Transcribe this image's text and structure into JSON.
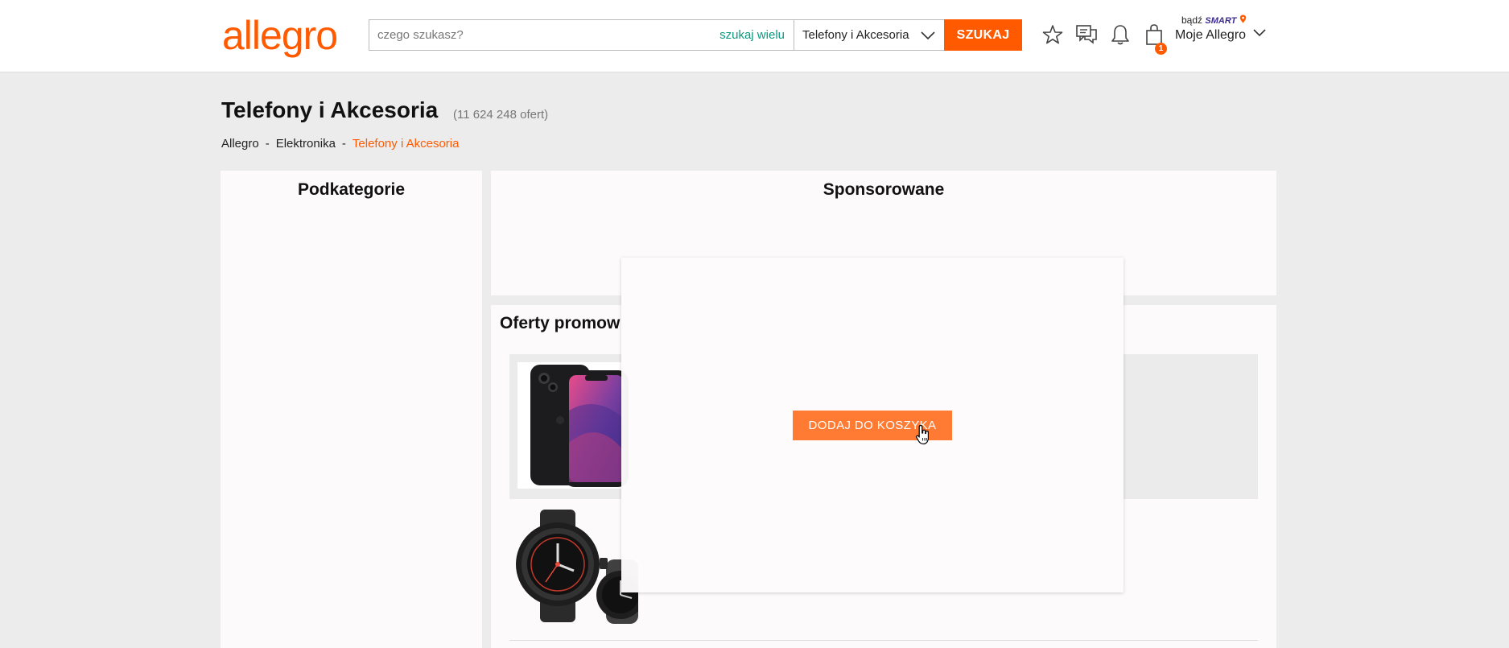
{
  "header": {
    "logo_text": "allegro",
    "search": {
      "placeholder": "czego szukasz?",
      "many_label": "szukaj wielu",
      "category_value": "Telefony i Akcesoria",
      "button_label": "SZUKAJ"
    },
    "cart_count": "1",
    "smart_prefix": "bądź",
    "smart_label": "SMART",
    "my_allegro_label": "Moje Allegro",
    "icons": [
      "star-icon",
      "messages-icon",
      "bell-icon",
      "cart-icon",
      "location-pin-icon",
      "chevron-down-icon"
    ]
  },
  "page": {
    "title": "Telefony i Akcesoria",
    "offer_count": "(11 624 248 ofert)",
    "breadcrumb": [
      {
        "label": "Allegro"
      },
      {
        "label": "Elektronika"
      },
      {
        "label": "Telefony i Akcesoria"
      }
    ],
    "breadcrumb_separator": "-"
  },
  "sections": {
    "subcategories_title": "Podkategorie",
    "sponsored_title": "Sponsorowane",
    "promoted_title": "Oferty promow"
  },
  "modal": {
    "button_label": "DODAJ DO KOSZYKA"
  },
  "colors": {
    "brand": "#ff5a00",
    "search_many": "#0b9a7f",
    "background": "#ececec",
    "add_to_cart": "#ff7a33"
  }
}
